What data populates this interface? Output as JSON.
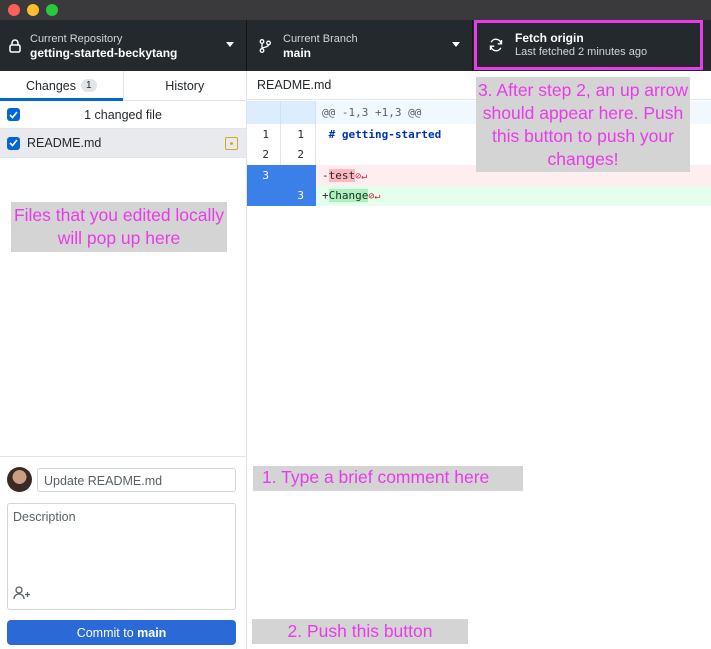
{
  "toolbar": {
    "repository": {
      "caption": "Current Repository",
      "name": "getting-started-beckytang"
    },
    "branch": {
      "caption": "Current Branch",
      "name": "main"
    },
    "fetch": {
      "title": "Fetch origin",
      "subtitle": "Last fetched 2 minutes ago"
    }
  },
  "sidebar": {
    "tabs": [
      {
        "label": "Changes",
        "count": "1"
      },
      {
        "label": "History"
      }
    ],
    "changed_files_label": "1 changed file",
    "files": [
      {
        "name": "README.md"
      }
    ]
  },
  "commit": {
    "summary": "Update README.md",
    "description_placeholder": "Description",
    "button_prefix": "Commit to",
    "button_branch": "main"
  },
  "diff": {
    "filename": "README.md",
    "hunk_header": "@@ -1,3 +1,3 @@",
    "lines": [
      {
        "old": "1",
        "new": "1",
        "text": " # getting-started"
      },
      {
        "old": "2",
        "new": "2",
        "text": ""
      },
      {
        "old": "3",
        "new": "",
        "prefix": "-",
        "word": "test"
      },
      {
        "old": "",
        "new": "3",
        "prefix": "+",
        "word": "Change"
      }
    ]
  },
  "annotations": {
    "files_note": "Files that you edited locally will pop up here",
    "step1": "1. Type a brief comment  here",
    "step2": "2. Push this button",
    "step3": "3. After step 2, an up arrow should appear here. Push this button to push your changes!"
  },
  "colors": {
    "accent": "#0366d6",
    "commit_button": "#2b6ad6",
    "annotation_text": "#e83ce8",
    "annotation_bg": "#d4d4d4",
    "toolbar_bg": "#24292e"
  }
}
